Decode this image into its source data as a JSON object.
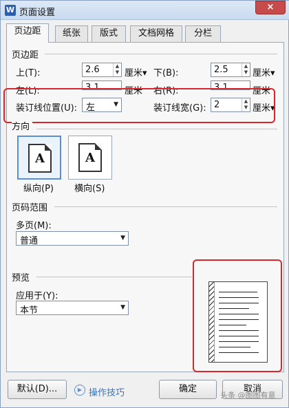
{
  "window": {
    "title": "页面设置",
    "app_icon": "W",
    "close_symbol": "×"
  },
  "tabs": [
    {
      "label": "页边距",
      "active": true
    },
    {
      "label": "纸张",
      "active": false
    },
    {
      "label": "版式",
      "active": false
    },
    {
      "label": "文档网格",
      "active": false
    },
    {
      "label": "分栏",
      "active": false
    }
  ],
  "margins": {
    "section_label": "页边距",
    "top": {
      "label": "上(T):",
      "value": "2.6",
      "unit": "厘米▾"
    },
    "bottom": {
      "label": "下(B):",
      "value": "2.5",
      "unit": "厘米▾"
    },
    "left": {
      "label": "左(L):",
      "value": "3.1",
      "unit": "厘米"
    },
    "right": {
      "label": "右(R):",
      "value": "3.1",
      "unit": "厘米"
    },
    "gutter_position": {
      "label": "装订线位置(U):",
      "value": "左"
    },
    "gutter_width": {
      "label": "装订线宽(G):",
      "value": "2",
      "unit": "厘米▾"
    }
  },
  "orientation": {
    "section_label": "方向",
    "portrait": {
      "label": "纵向(P)",
      "selected": true
    },
    "landscape": {
      "label": "横向(S)",
      "selected": false
    },
    "glyph": "A"
  },
  "page_range": {
    "section_label": "页码范围",
    "multiple_pages_label": "多页(M):",
    "value": "普通"
  },
  "preview": {
    "section_label": "预览",
    "apply_to_label": "应用于(Y):",
    "apply_to_value": "本节"
  },
  "footer": {
    "default_button": "默认(D)...",
    "tips_link": "操作技巧",
    "ok_button": "确定",
    "cancel_button": "取消"
  },
  "watermark": "头条 @图图有意",
  "colors": {
    "highlight": "#d9262b",
    "accent": "#5a8fcf"
  }
}
